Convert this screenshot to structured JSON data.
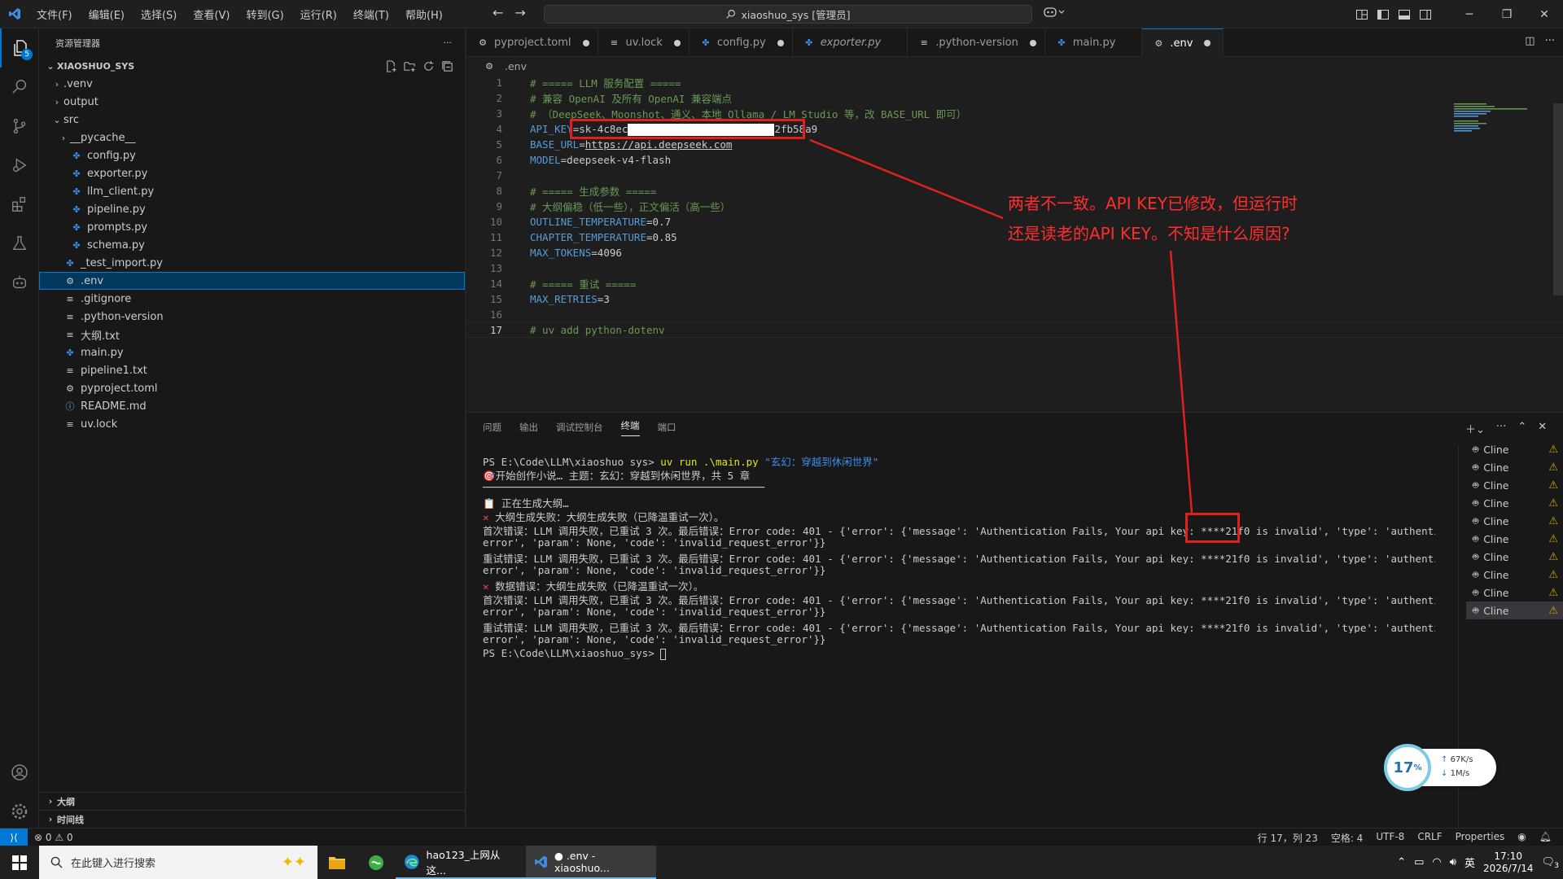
{
  "titlebar": {
    "menus": [
      "文件(F)",
      "编辑(E)",
      "选择(S)",
      "查看(V)",
      "转到(G)",
      "运行(R)",
      "终端(T)",
      "帮助(H)"
    ],
    "command_center": "xiaoshuo_sys [管理员]"
  },
  "activity": {
    "explorer_badge": "5"
  },
  "sidebar": {
    "title": "资源管理器",
    "folder": "XIAOSHUO_SYS",
    "tree": [
      {
        "label": ".venv",
        "indent": 1,
        "kind": "folder-closed"
      },
      {
        "label": "output",
        "indent": 1,
        "kind": "folder-closed"
      },
      {
        "label": "src",
        "indent": 1,
        "kind": "folder-open"
      },
      {
        "label": "__pycache__",
        "indent": 2,
        "kind": "folder-closed"
      },
      {
        "label": "config.py",
        "indent": 2,
        "kind": "py"
      },
      {
        "label": "exporter.py",
        "indent": 2,
        "kind": "py"
      },
      {
        "label": "llm_client.py",
        "indent": 2,
        "kind": "py"
      },
      {
        "label": "pipeline.py",
        "indent": 2,
        "kind": "py"
      },
      {
        "label": "prompts.py",
        "indent": 2,
        "kind": "py"
      },
      {
        "label": "schema.py",
        "indent": 2,
        "kind": "py"
      },
      {
        "label": "_test_import.py",
        "indent": 1,
        "kind": "py"
      },
      {
        "label": ".env",
        "indent": 1,
        "kind": "gear",
        "selected": true
      },
      {
        "label": ".gitignore",
        "indent": 1,
        "kind": "txt"
      },
      {
        "label": ".python-version",
        "indent": 1,
        "kind": "txt"
      },
      {
        "label": "大纲.txt",
        "indent": 1,
        "kind": "txt"
      },
      {
        "label": "main.py",
        "indent": 1,
        "kind": "py"
      },
      {
        "label": "pipeline1.txt",
        "indent": 1,
        "kind": "txt"
      },
      {
        "label": "pyproject.toml",
        "indent": 1,
        "kind": "gear"
      },
      {
        "label": "README.md",
        "indent": 1,
        "kind": "info"
      },
      {
        "label": "uv.lock",
        "indent": 1,
        "kind": "txt"
      }
    ],
    "panes": [
      "大纲",
      "时间线"
    ]
  },
  "tabs": [
    {
      "label": "pyproject.toml",
      "icon": "gear",
      "dirty": true
    },
    {
      "label": "uv.lock",
      "icon": "txt",
      "dirty": true
    },
    {
      "label": "config.py",
      "icon": "py",
      "dirty": true
    },
    {
      "label": "exporter.py",
      "icon": "py",
      "italic": true
    },
    {
      "label": ".python-version",
      "icon": "txt",
      "dirty": true
    },
    {
      "label": "main.py",
      "icon": "py"
    },
    {
      "label": ".env",
      "icon": "gear",
      "dirty": true,
      "active": true
    }
  ],
  "breadcrumb": ".env",
  "code": {
    "l1": "# ===== LLM 服务配置 =====",
    "l2": "# 兼容 OpenAI 及所有 OpenAI 兼容端点",
    "l3": "# （DeepSeek、Moonshot、通义、本地 Ollama / LM Studio 等，改 BASE_URL 即可）",
    "l4_key": "API_KEY",
    "l4_prefix": "sk-4c8ec",
    "l4_suffix": "2fb58a9",
    "l5_key": "BASE_URL",
    "l5_val": "https://api.deepseek.com",
    "l6_key": "MODEL",
    "l6_val": "deepseek-v4-flash",
    "l8": "# ===== 生成参数 =====",
    "l9": "# 大纲偏稳（低一些），正文偏活（高一些）",
    "l10_key": "OUTLINE_TEMPERATURE",
    "l10_val": "0.7",
    "l11_key": "CHAPTER_TEMPERATURE",
    "l11_val": "0.85",
    "l12_key": "MAX_TOKENS",
    "l12_val": "4096",
    "l14": "# ===== 重试 =====",
    "l15_key": "MAX_RETRIES",
    "l15_val": "3",
    "l17": "# uv add python-dotenv"
  },
  "annotation": {
    "line1": "两者不一致。API KEY已修改，但运行时",
    "line2": "还是读老的API KEY。不知是什么原因?"
  },
  "panel": {
    "tabs": [
      "问题",
      "输出",
      "调试控制台",
      "终端",
      "端口"
    ],
    "terminal": {
      "prompt1": "PS E:\\Code\\LLM\\xiaoshuo_sys> ",
      "cmd": "uv run .\\main.py ",
      "cmd_arg": "\"玄幻：穿越到休闲世界\"",
      "start": "🎯开始创作小说… 主题：玄幻：穿越到休闲世界，共 5 章",
      "sep": "──────────────────────────────────────────────",
      "gen": "📋 正在生成大纲…",
      "fail1": "大纲生成失败：大纲生成失败（已降温重试一次）。",
      "e1a_pre": "首次错误：LLM 调用失败，已重试 3 次。最后错误：Error code: 401 - {'error': {'message': 'Authentication Fails, Your api key: ",
      "masked_key": "****21f0",
      "e1a_post": " is invalid', 'type': 'authentication_",
      "e1b": "error', 'param': None, 'code': 'invalid_request_error'}}",
      "e2a": "重试错误：LLM 调用失败，已重试 3 次。最后错误：Error code: 401 - {'error': {'message': 'Authentication Fails, Your api key: ****21f0 is invalid', 'type': 'authentication_",
      "e2b": "error', 'param': None, 'code': 'invalid_request_error'}}",
      "fail2": "数据错误：大纲生成失败（已降温重试一次）。",
      "e3a": "首次错误：LLM 调用失败，已重试 3 次。最后错误：Error code: 401 - {'error': {'message': 'Authentication Fails, Your api key: ****21f0 is invalid', 'type': 'authentication_",
      "e3b": "error', 'param': None, 'code': 'invalid_request_error'}}",
      "e4a": "重试错误：LLM 调用失败，已重试 3 次。最后错误：Error code: 401 - {'error': {'message': 'Authentication Fails, Your api key: ****21f0 is invalid', 'type': 'authentication_",
      "e4b": "error', 'param': None, 'code': 'invalid_request_error'}}",
      "prompt2": "PS E:\\Code\\LLM\\xiaoshuo_sys> "
    },
    "term_list": [
      "Cline",
      "Cline",
      "Cline",
      "Cline",
      "Cline",
      "Cline",
      "Cline",
      "Cline",
      "Cline",
      "Cline"
    ]
  },
  "widget": {
    "cpu": "17",
    "cpu_unit": "%",
    "up": "67K/s",
    "down": "1M/s"
  },
  "statusbar": {
    "problems": "0",
    "warnings": "0",
    "position": "行 17，列 23",
    "spaces": "空格: 4",
    "encoding": "UTF-8",
    "eol": "CRLF",
    "language": "Properties"
  },
  "taskbar": {
    "search_placeholder": "在此键入进行搜索",
    "apps": [
      {
        "label": "hao123_上网从这...",
        "icon": "edge"
      },
      {
        "label": "● .env - xiaoshuo...",
        "icon": "vscode",
        "active": true
      }
    ],
    "ime": "英",
    "time": "17:10",
    "date": "2026/7/14",
    "notif": "3"
  },
  "colors": {
    "accent": "#0078d4",
    "annotation": "#e02020"
  }
}
